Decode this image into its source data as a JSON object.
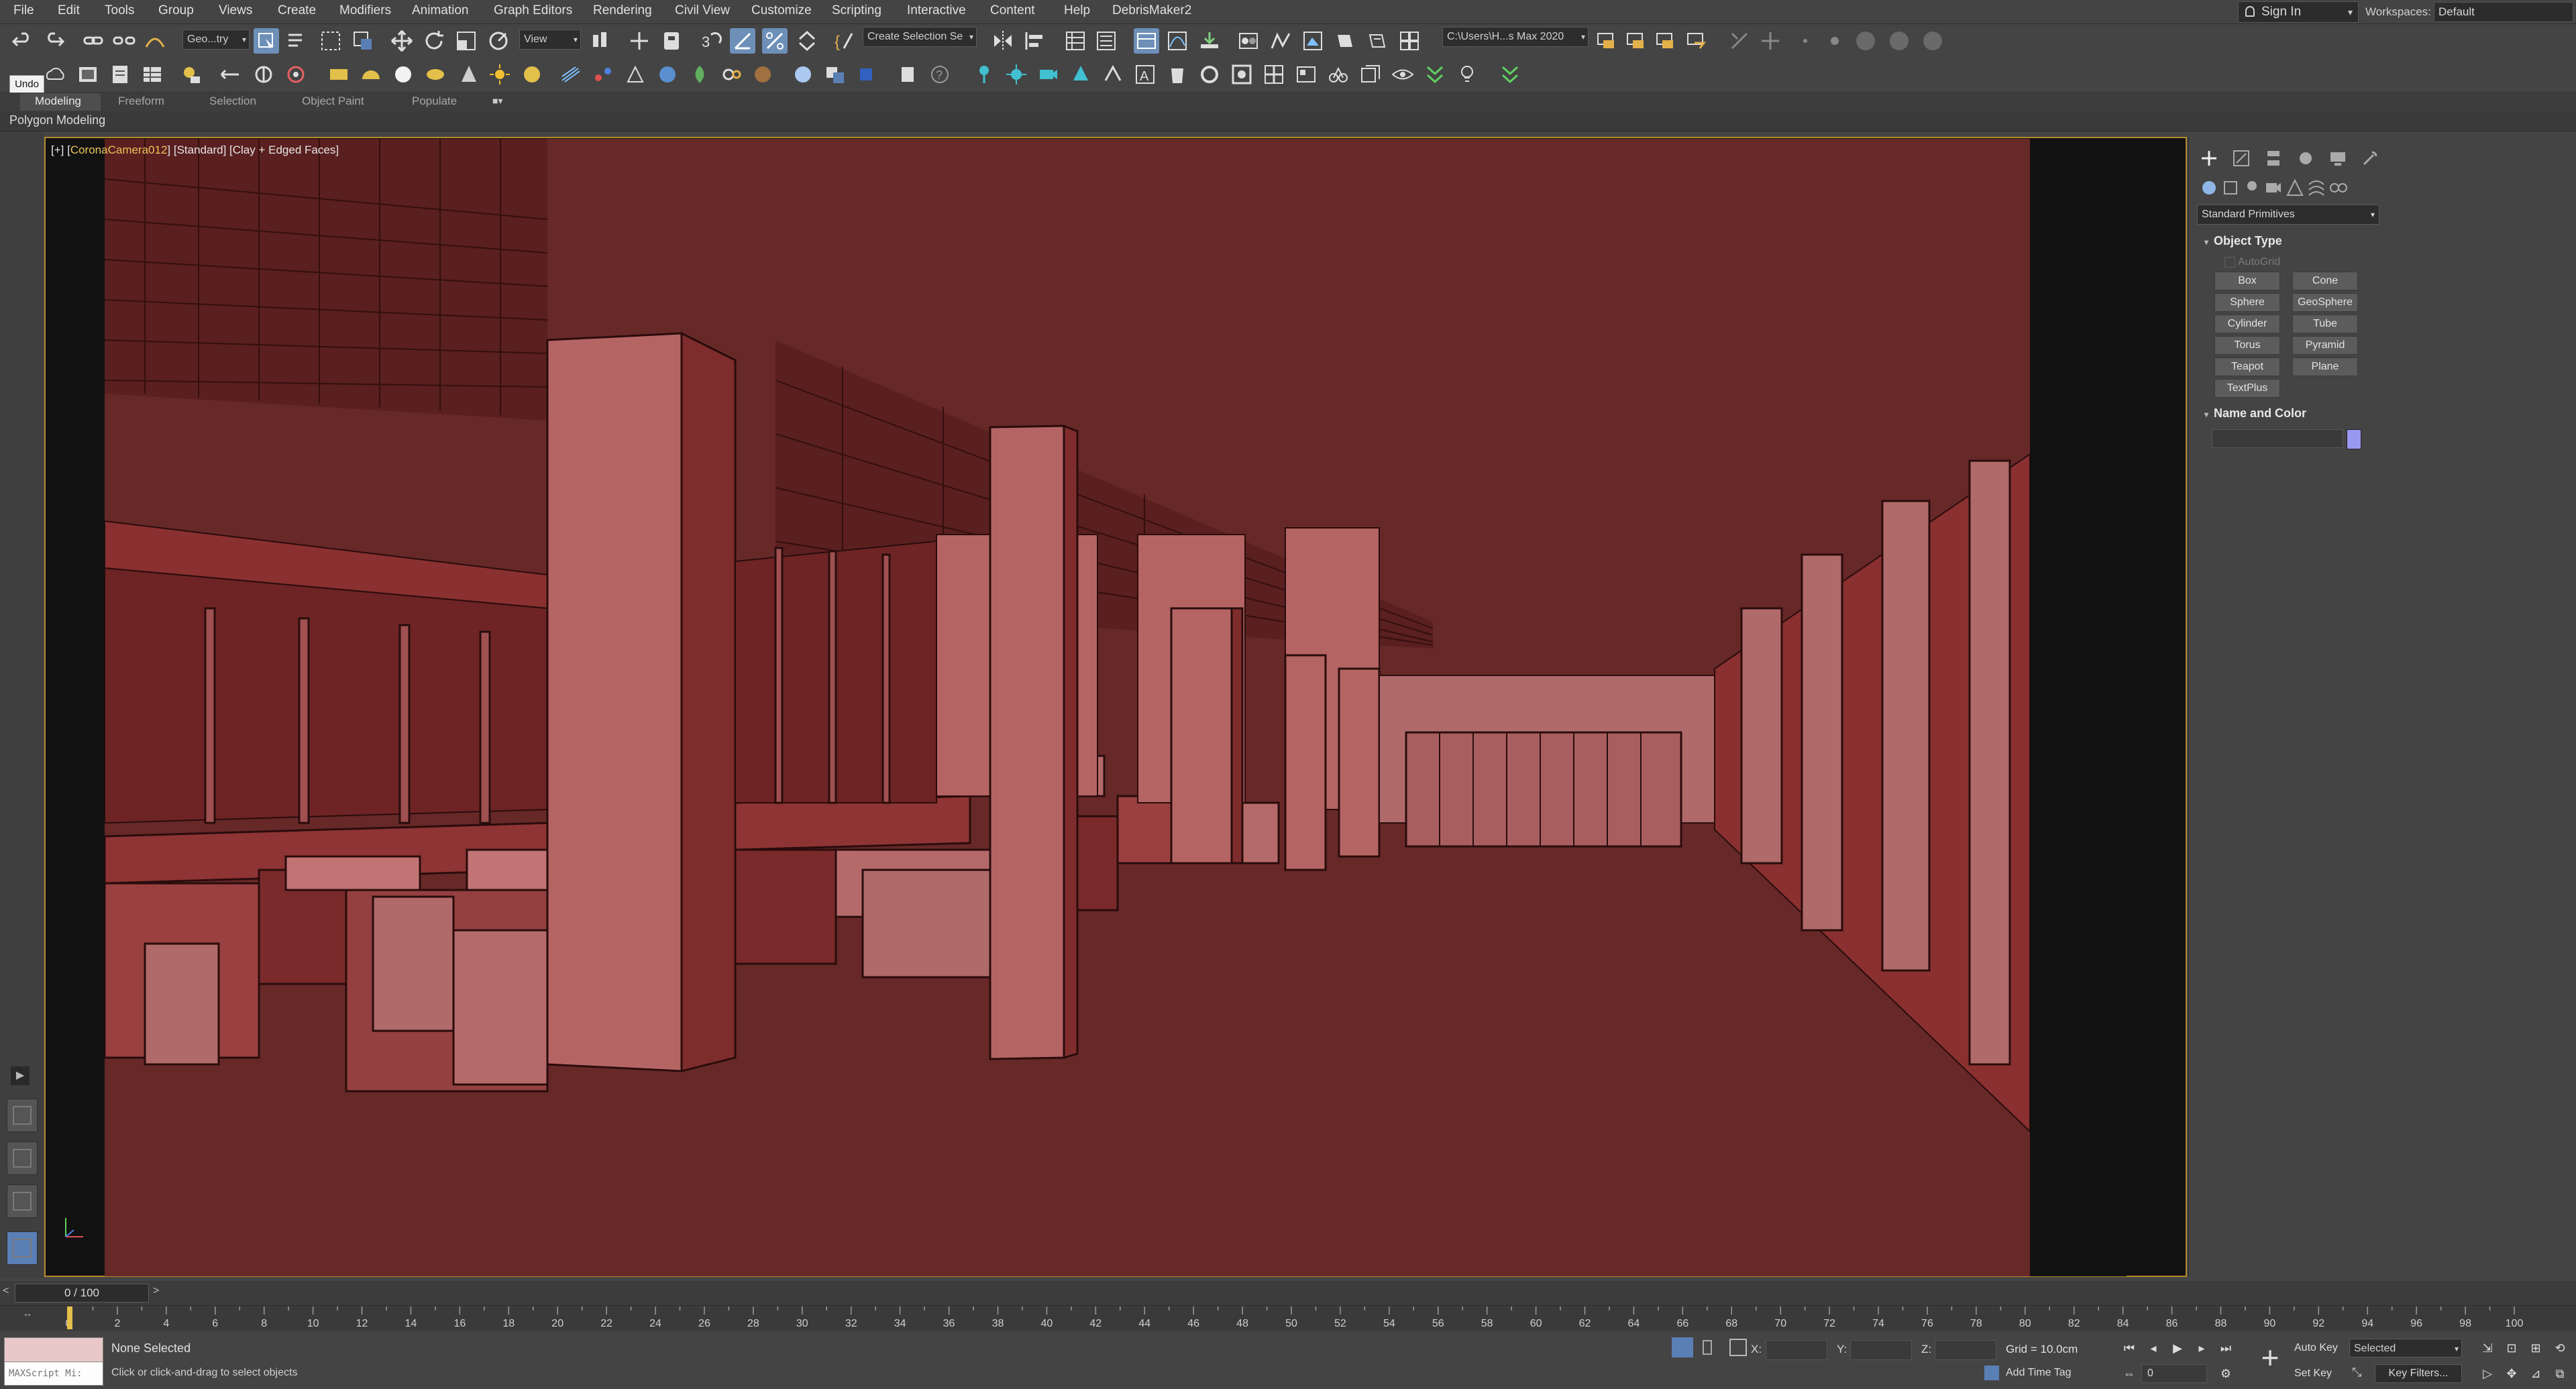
{
  "menubar": {
    "items": [
      "File",
      "Edit",
      "Tools",
      "Group",
      "Views",
      "Create",
      "Modifiers",
      "Animation",
      "Graph Editors",
      "Rendering",
      "Civil View",
      "Customize",
      "Scripting",
      "Interactive",
      "Content",
      "Help",
      "DebrisMaker2"
    ],
    "sign_in": "Sign In",
    "workspaces_label": "Workspaces:",
    "workspaces_value": "Default"
  },
  "toolbar": {
    "selection_filter": "Geo...try",
    "ref_coord": "View",
    "named_selection": "Create Selection Se",
    "project_path": "C:\\Users\\H...s Max 2020",
    "undo_tooltip": "Undo"
  },
  "ribbon": {
    "tabs": [
      "Modeling",
      "Freeform",
      "Selection",
      "Object Paint",
      "Populate"
    ],
    "active_tab": "Modeling",
    "panel_label": "Polygon Modeling"
  },
  "viewport": {
    "label_prefix": "[+] [",
    "camera": "CoronaCamera012",
    "label_suffix": "] [Standard] [Clay + Edged Faces]",
    "scene_color": "#672828"
  },
  "command_panel": {
    "category": "Standard Primitives",
    "object_type_title": "Object Type",
    "autogrid": "AutoGrid",
    "primitives": [
      "Box",
      "Cone",
      "Sphere",
      "GeoSphere",
      "Cylinder",
      "Tube",
      "Torus",
      "Pyramid",
      "Teapot",
      "Plane",
      "TextPlus"
    ],
    "name_color_title": "Name and Color",
    "object_color": "#9898f0"
  },
  "timeline": {
    "frame_display": "0 / 100",
    "tick_labels": [
      "0",
      "2",
      "4",
      "6",
      "8",
      "10",
      "12",
      "14",
      "16",
      "18",
      "20",
      "22",
      "24",
      "26",
      "28",
      "30",
      "32",
      "34",
      "36",
      "38",
      "40",
      "42",
      "44",
      "46",
      "48",
      "50",
      "52",
      "54",
      "56",
      "58",
      "60",
      "62",
      "64",
      "66",
      "68",
      "70",
      "72",
      "74",
      "76",
      "78",
      "80",
      "82",
      "84",
      "86",
      "88",
      "90",
      "92",
      "94",
      "96",
      "98",
      "100"
    ]
  },
  "status": {
    "maxscript": "MAXScript Mi:",
    "selection": "None Selected",
    "hint": "Click or click-and-drag to select objects",
    "x_label": "X:",
    "y_label": "Y:",
    "z_label": "Z:",
    "grid": "Grid = 10.0cm",
    "add_time_tag": "Add Time Tag",
    "auto_key": "Auto Key",
    "set_key": "Set Key",
    "selected": "Selected",
    "key_filters": "Key Filters...",
    "current_frame": "0"
  }
}
